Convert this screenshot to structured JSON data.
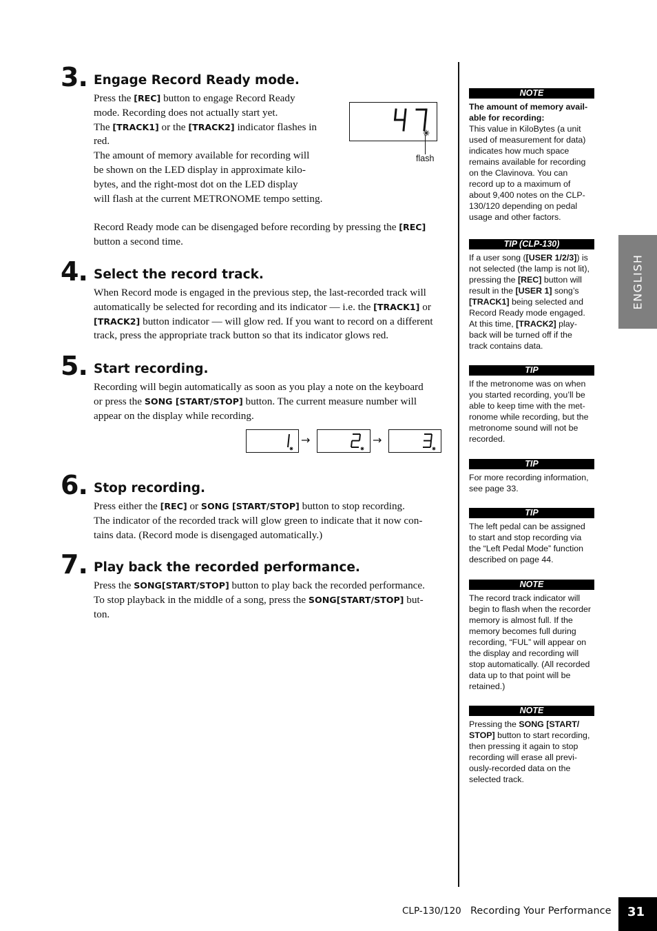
{
  "steps": [
    {
      "number": "3.",
      "title": "Engage Record Ready mode.",
      "paragraphs": [
        [
          "Press the ",
          {
            "b": "[REC]"
          },
          " button to engage Record Ready"
        ],
        [
          "mode. Recording does not actually start yet."
        ],
        [
          "The ",
          {
            "b": "[TRACK1]"
          },
          " or the ",
          {
            "b": "[TRACK2]"
          },
          " indicator flashes in"
        ],
        [
          "red."
        ],
        [
          "The amount of memory available for recording will"
        ],
        [
          "be shown on the LED display in approximate kilo-"
        ],
        [
          "bytes, and the right-most dot on the LED display"
        ],
        [
          "will flash at the current METRONOME tempo setting."
        ],
        [
          ""
        ],
        [
          "Record Ready mode can be disengaged before recording by pressing the ",
          {
            "b": "[REC]"
          }
        ],
        [
          "button a second time."
        ]
      ]
    },
    {
      "number": "4.",
      "title": "Select the record track.",
      "paragraphs": [
        [
          "When Record mode is engaged in the previous step, the last-recorded track will"
        ],
        [
          "automatically be selected for recording and its indicator — i.e. the ",
          {
            "b": "[TRACK1]"
          },
          " or"
        ],
        [
          {
            "b": "[TRACK2]"
          },
          " button indicator — will glow red. If you want to record on a different"
        ],
        [
          "track, press the appropriate track button so that its indicator glows red."
        ]
      ]
    },
    {
      "number": "5.",
      "title": "Start recording.",
      "paragraphs": [
        [
          "Recording will begin automatically as soon as you play a note on the keyboard"
        ],
        [
          "or press the ",
          {
            "b": "SONG [START/STOP]"
          },
          " button. The current measure number will"
        ],
        [
          "appear on the display while recording."
        ]
      ]
    },
    {
      "number": "6.",
      "title": "Stop recording.",
      "paragraphs": [
        [
          "Press either the ",
          {
            "b": "[REC]"
          },
          " or ",
          {
            "b": "SONG [START/STOP]"
          },
          " button to stop recording."
        ],
        [
          "The indicator of the recorded track will glow green to indicate that it now con-"
        ],
        [
          "tains data. (Record mode is disengaged automatically.)"
        ]
      ]
    },
    {
      "number": "7.",
      "title": "Play back the recorded performance.",
      "paragraphs": [
        [
          "Press the ",
          {
            "b": "SONG[START/STOP]"
          },
          " button to play back the recorded performance."
        ],
        [
          "To stop playback in the middle of a song, press the ",
          {
            "b": "SONG[START/STOP]"
          },
          " but-"
        ],
        [
          "ton."
        ]
      ]
    }
  ],
  "led_memory_display": {
    "value": "47",
    "callout_label": "flash"
  },
  "led_measure_sequence": [
    "1",
    "2",
    "3"
  ],
  "sidebar": [
    {
      "heading": "NOTE",
      "lines": [
        [
          {
            "b": "The amount of memory avail-"
          }
        ],
        [
          {
            "b": "able for recording:"
          }
        ],
        [
          "This value in KiloBytes (a unit"
        ],
        [
          "used of measurement for data)"
        ],
        [
          "indicates how much space"
        ],
        [
          "remains available for recording"
        ],
        [
          "on the Clavinova. You can"
        ],
        [
          "record up to a maximum of"
        ],
        [
          "about 9,400 notes on the CLP-"
        ],
        [
          "130/120 depending on pedal"
        ],
        [
          "usage and other factors."
        ]
      ]
    },
    {
      "heading": "TIP (CLP-130)",
      "lines": [
        [
          "If a user song (",
          {
            "b": "[USER 1/2/3]"
          },
          ") is"
        ],
        [
          "not selected (the lamp is not lit),"
        ],
        [
          "pressing the ",
          {
            "b": "[REC]"
          },
          " button will"
        ],
        [
          "result in the ",
          {
            "b": "[USER 1]"
          },
          " song’s"
        ],
        [
          {
            "b": "[TRACK1]"
          },
          " being selected and"
        ],
        [
          "Record Ready mode engaged."
        ],
        [
          "At this time, ",
          {
            "b": "[TRACK2]"
          },
          " play-"
        ],
        [
          "back will be turned off if the"
        ],
        [
          "track contains data."
        ]
      ]
    },
    {
      "heading": "TIP",
      "lines": [
        [
          "If the metronome was on when"
        ],
        [
          "you started recording, you’ll be"
        ],
        [
          "able to keep time with the met-"
        ],
        [
          "ronome while recording, but the"
        ],
        [
          "metronome sound will not be"
        ],
        [
          "recorded."
        ]
      ]
    },
    {
      "heading": "TIP",
      "lines": [
        [
          "For more recording information,"
        ],
        [
          "see page 33."
        ]
      ]
    },
    {
      "heading": "TIP",
      "lines": [
        [
          "The left pedal can be assigned"
        ],
        [
          "to start and stop recording via"
        ],
        [
          "the “Left Pedal Mode” function"
        ],
        [
          "described on page 44."
        ]
      ]
    },
    {
      "heading": "NOTE",
      "lines": [
        [
          "The record track indicator will"
        ],
        [
          "begin to flash when the recorder"
        ],
        [
          "memory is almost full. If the"
        ],
        [
          "memory becomes full during"
        ],
        [
          "recording, “FUL” will appear on"
        ],
        [
          "the display and recording will"
        ],
        [
          "stop automatically. (All recorded"
        ],
        [
          "data up to that point will be"
        ],
        [
          "retained.)"
        ]
      ]
    },
    {
      "heading": "NOTE",
      "lines": [
        [
          "Pressing the ",
          {
            "b": "SONG [START/"
          }
        ],
        [
          {
            "b": "STOP]"
          },
          " button to start recording,"
        ],
        [
          "then pressing it again to stop"
        ],
        [
          "recording will erase all previ-"
        ],
        [
          "ously-recorded data on the"
        ],
        [
          "selected track."
        ]
      ]
    }
  ],
  "language_tab": "ENGLISH",
  "footer": {
    "model": "CLP-130/120",
    "section": "Recording Your Performance",
    "page_number": "31"
  }
}
